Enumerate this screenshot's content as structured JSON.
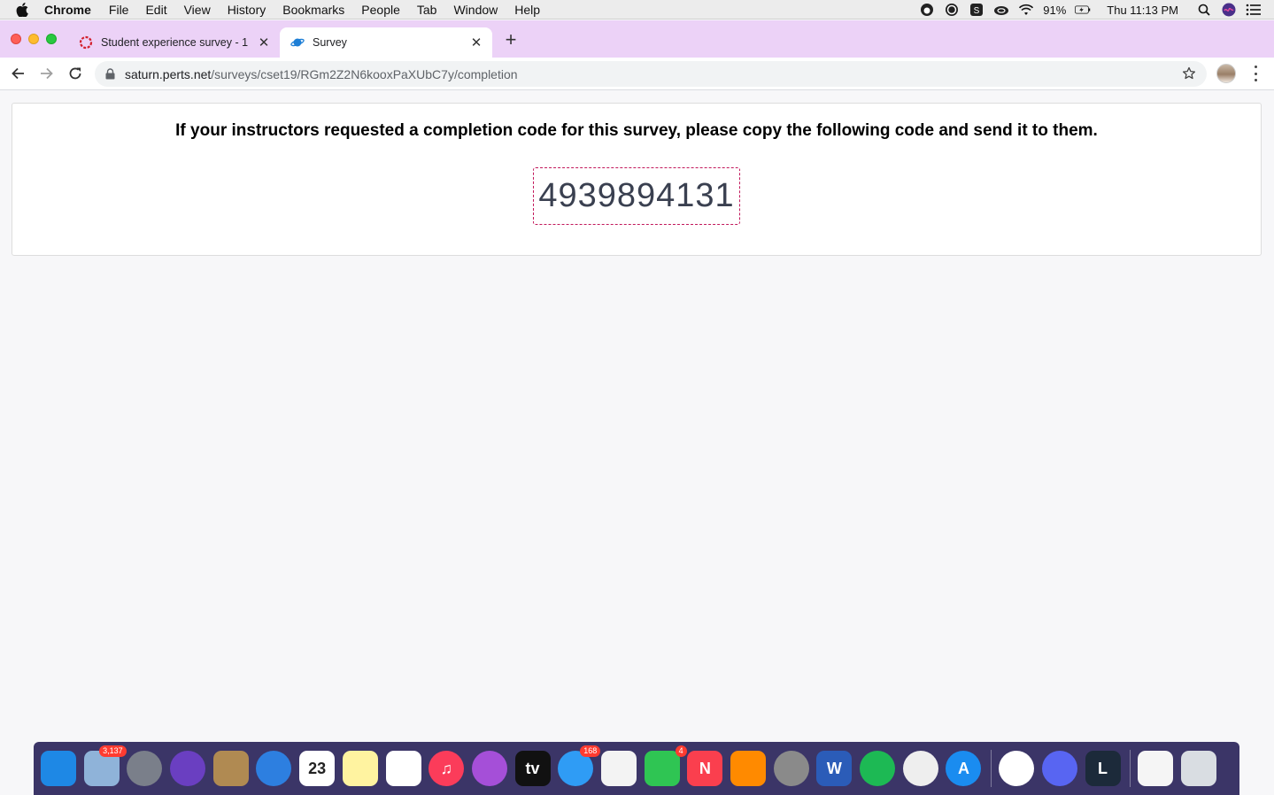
{
  "menubar": {
    "app_name": "Chrome",
    "items": [
      "File",
      "Edit",
      "View",
      "History",
      "Bookmarks",
      "People",
      "Tab",
      "Window",
      "Help"
    ],
    "battery": "91%",
    "clock": "Thu 11:13 PM"
  },
  "tabs": [
    {
      "title": "Student experience survey - 1",
      "icon": "ring-icon",
      "active": false
    },
    {
      "title": "Survey",
      "icon": "planet-icon",
      "active": true
    }
  ],
  "toolbar": {
    "url_host": "saturn.perts.net",
    "url_path": "/surveys/cset19/RGm2Z2N6kooxPaXUbC7y/completion"
  },
  "page": {
    "instructions": "If your instructors requested a completion code for this survey, please copy the following code and send it to them.",
    "completion_code": "4939894131"
  },
  "dock": {
    "apps": [
      {
        "name": "finder",
        "label": "",
        "color": "#1e88e5",
        "badge": ""
      },
      {
        "name": "mail",
        "label": "",
        "color": "#8fb3d9",
        "badge": "3,137"
      },
      {
        "name": "launchpad",
        "label": "",
        "color": "#7a7f8a",
        "badge": ""
      },
      {
        "name": "siri",
        "label": "",
        "color": "#6a3fc1",
        "badge": ""
      },
      {
        "name": "contacts",
        "label": "",
        "color": "#b08a52",
        "badge": ""
      },
      {
        "name": "safari",
        "label": "",
        "color": "#2d7fe0",
        "badge": ""
      },
      {
        "name": "calendar",
        "label": "23",
        "color": "#ffffff",
        "badge": ""
      },
      {
        "name": "notes",
        "label": "",
        "color": "#fff3a0",
        "badge": ""
      },
      {
        "name": "reminders",
        "label": "",
        "color": "#ffffff",
        "badge": ""
      },
      {
        "name": "music",
        "label": "♫",
        "color": "#fb3c5a",
        "badge": ""
      },
      {
        "name": "podcasts",
        "label": "",
        "color": "#a54fd8",
        "badge": ""
      },
      {
        "name": "tv",
        "label": "tv",
        "color": "#111111",
        "badge": ""
      },
      {
        "name": "messages",
        "label": "",
        "color": "#2f9cf5",
        "badge": "168"
      },
      {
        "name": "photos",
        "label": "",
        "color": "#f3f3f3",
        "badge": ""
      },
      {
        "name": "facetime",
        "label": "",
        "color": "#2fc553",
        "badge": "4"
      },
      {
        "name": "news",
        "label": "N",
        "color": "#fa3f4e",
        "badge": ""
      },
      {
        "name": "books",
        "label": "",
        "color": "#ff8a00",
        "badge": ""
      },
      {
        "name": "system-preferences",
        "label": "",
        "color": "#8a8a8a",
        "badge": ""
      },
      {
        "name": "word",
        "label": "W",
        "color": "#2b5cb8",
        "badge": ""
      },
      {
        "name": "spotify",
        "label": "",
        "color": "#1db954",
        "badge": ""
      },
      {
        "name": "chrome",
        "label": "",
        "color": "#eeeeee",
        "badge": ""
      },
      {
        "name": "app-store",
        "label": "A",
        "color": "#1a8cf0",
        "badge": ""
      }
    ],
    "apps_after": [
      {
        "name": "xbox",
        "label": "",
        "color": "#ffffff",
        "badge": ""
      },
      {
        "name": "discord",
        "label": "",
        "color": "#5865f2",
        "badge": ""
      },
      {
        "name": "league-of-legends",
        "label": "L",
        "color": "#1c2a3a",
        "badge": ""
      }
    ],
    "apps_end": [
      {
        "name": "document",
        "label": "",
        "color": "#f5f5f5",
        "badge": ""
      },
      {
        "name": "trash",
        "label": "",
        "color": "#d9dde2",
        "badge": ""
      }
    ]
  }
}
